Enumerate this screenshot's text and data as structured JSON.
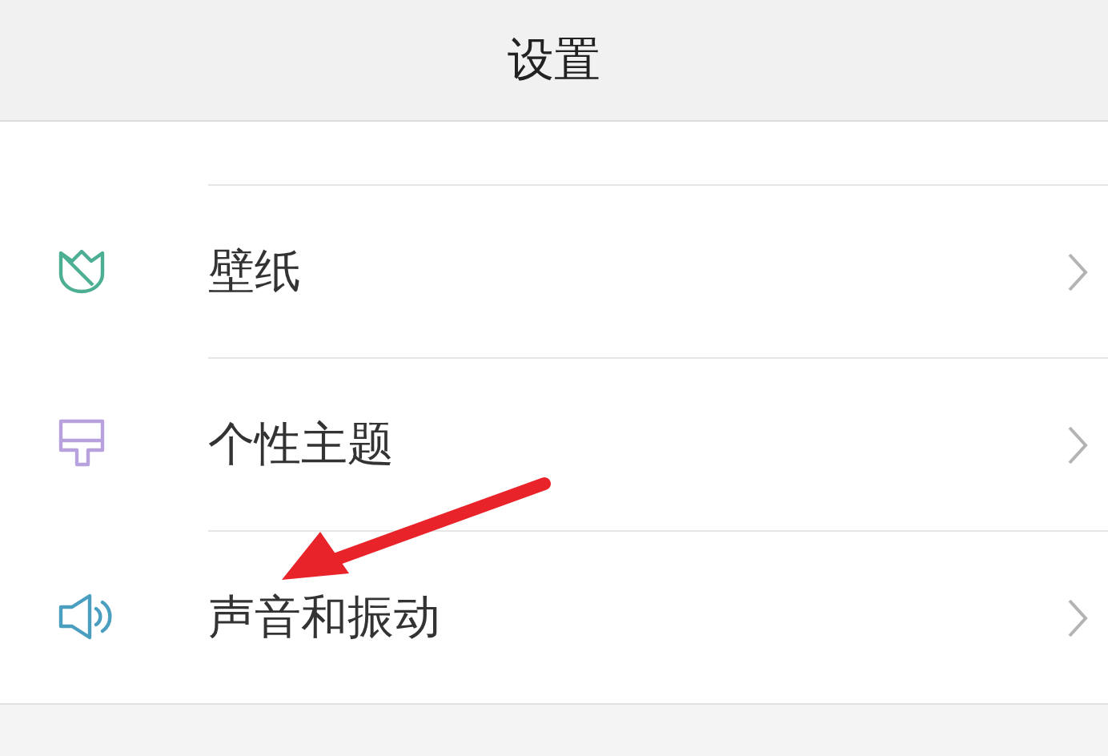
{
  "header": {
    "title": "设置"
  },
  "items": [
    {
      "kind": "tulip",
      "label": "壁纸"
    },
    {
      "kind": "brush",
      "label": "个性主题"
    },
    {
      "kind": "speaker",
      "label": "声音和振动"
    }
  ],
  "annotation": {
    "kind": "arrow"
  }
}
